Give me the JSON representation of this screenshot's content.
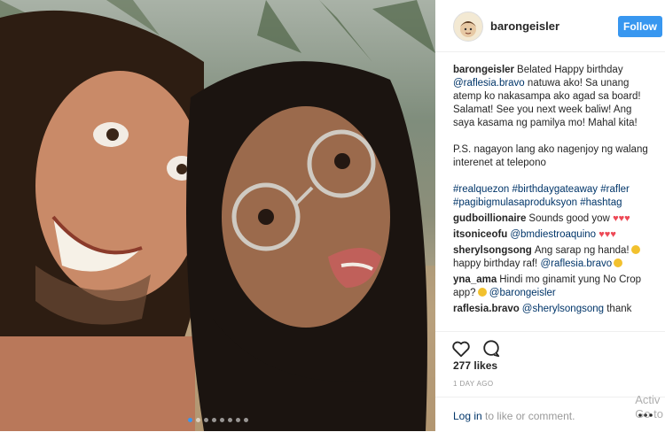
{
  "post": {
    "username": "barongeisler",
    "follow_label": "Follow",
    "caption": {
      "user": "barongeisler",
      "text_a": "Belated Happy birthday",
      "mention": "@raflesia.bravo",
      "text_b": "natuwa ako! Sa unang atemp ko nakasampa ako agad sa board! Salamat! See you next week baliw! Ang saya kasama ng pamilya mo! Mahal kita!",
      "text_c": "P.S. nagayon lang ako nagenjoy ng walang interenet at telepono",
      "hashtags": [
        "#realquezon",
        "#birthdaygateaway",
        "#rafler",
        "#pagibigmulasaproduksyon",
        "#hashtag"
      ]
    },
    "comments": [
      {
        "user": "gudboillionaire",
        "text": "Sounds good yow",
        "hearts": "♥♥♥"
      },
      {
        "user": "itsoniceofu",
        "mention": "@bmdiestroaquino",
        "hearts": "♥♥♥"
      },
      {
        "user": "sherylsongsong",
        "text_a": "Ang sarap ng handa!",
        "text_b": "happy birthday raf!",
        "mention": "@raflesia.bravo"
      },
      {
        "user": "yna_ama",
        "text": "Hindi mo ginamit yung No Crop app?",
        "mention": "@barongeisler"
      },
      {
        "user": "raflesia.bravo",
        "mention": "@sherylsongsong",
        "text": "thank"
      }
    ],
    "likes": "277 likes",
    "date": "1 DAY AGO",
    "login": {
      "link": "Log in",
      "rest": " to like or comment."
    },
    "carousel_count": 8,
    "carousel_active": 1
  },
  "watermark": {
    "line1": "Activ",
    "line2": "Go to"
  },
  "colors": {
    "accent": "#3897f0",
    "link": "#003569",
    "muted": "#999999",
    "heart": "#ed4956"
  },
  "icons": {
    "like": "heart-outline-icon",
    "comment": "comment-bubble-icon",
    "more": "more-dots-icon"
  }
}
